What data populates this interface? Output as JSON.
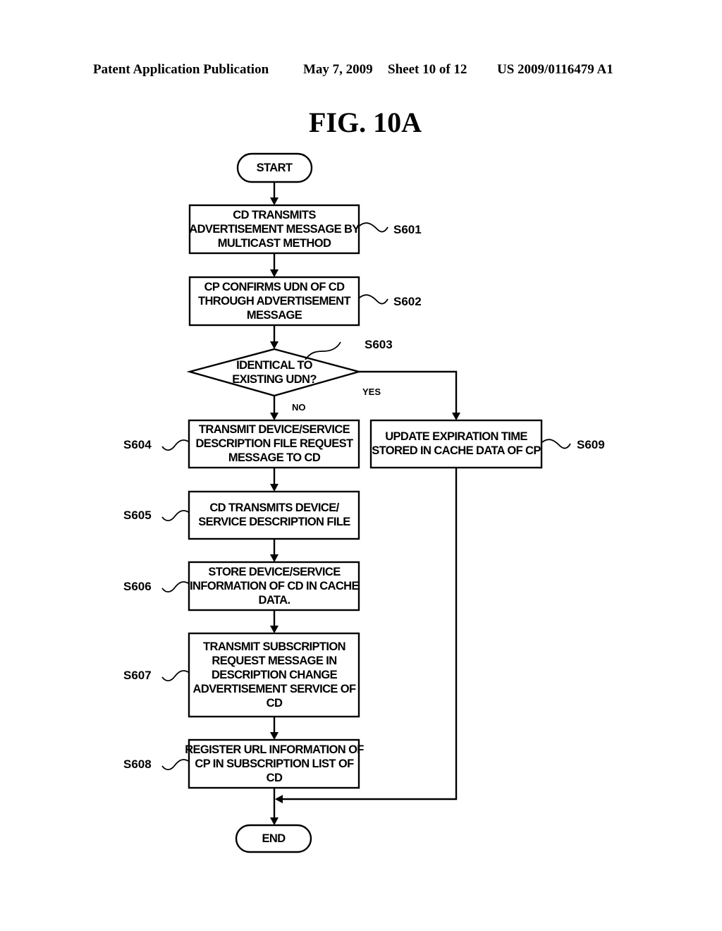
{
  "header": {
    "publication": "Patent Application Publication",
    "date": "May 7, 2009",
    "sheet": "Sheet 10 of 12",
    "number": "US 2009/0116479 A1"
  },
  "figure": {
    "title": "FIG. 10A"
  },
  "flowchart": {
    "start": "START",
    "end": "END",
    "steps": {
      "s601": {
        "ref": "S601",
        "lines": [
          "CD TRANSMITS",
          "ADVERTISEMENT MESSAGE BY",
          "MULTICAST METHOD"
        ]
      },
      "s602": {
        "ref": "S602",
        "lines": [
          "CP CONFIRMS UDN OF CD",
          "THROUGH ADVERTISEMENT",
          "MESSAGE"
        ]
      },
      "s603": {
        "ref": "S603",
        "lines": [
          "IDENTICAL TO",
          "EXISTING UDN?"
        ]
      },
      "s604": {
        "ref": "S604",
        "lines": [
          "TRANSMIT DEVICE/SERVICE",
          "DESCRIPTION FILE REQUEST",
          "MESSAGE TO CD"
        ]
      },
      "s605": {
        "ref": "S605",
        "lines": [
          "CD TRANSMITS DEVICE/",
          "SERVICE DESCRIPTION FILE"
        ]
      },
      "s606": {
        "ref": "S606",
        "lines": [
          "STORE DEVICE/SERVICE",
          "INFORMATION OF CD IN CACHE",
          "DATA."
        ]
      },
      "s607": {
        "ref": "S607",
        "lines": [
          "TRANSMIT SUBSCRIPTION",
          "REQUEST MESSAGE IN",
          "DESCRIPTION CHANGE",
          "ADVERTISEMENT SERVICE OF",
          "CD"
        ]
      },
      "s608": {
        "ref": "S608",
        "lines": [
          "REGISTER URL INFORMATION OF",
          "CP IN SUBSCRIPTION LIST OF",
          "CD"
        ]
      },
      "s609": {
        "ref": "S609",
        "lines": [
          "UPDATE EXPIRATION TIME",
          "STORED IN CACHE DATA OF CP"
        ]
      }
    },
    "branch_yes": "YES",
    "branch_no": "NO"
  }
}
